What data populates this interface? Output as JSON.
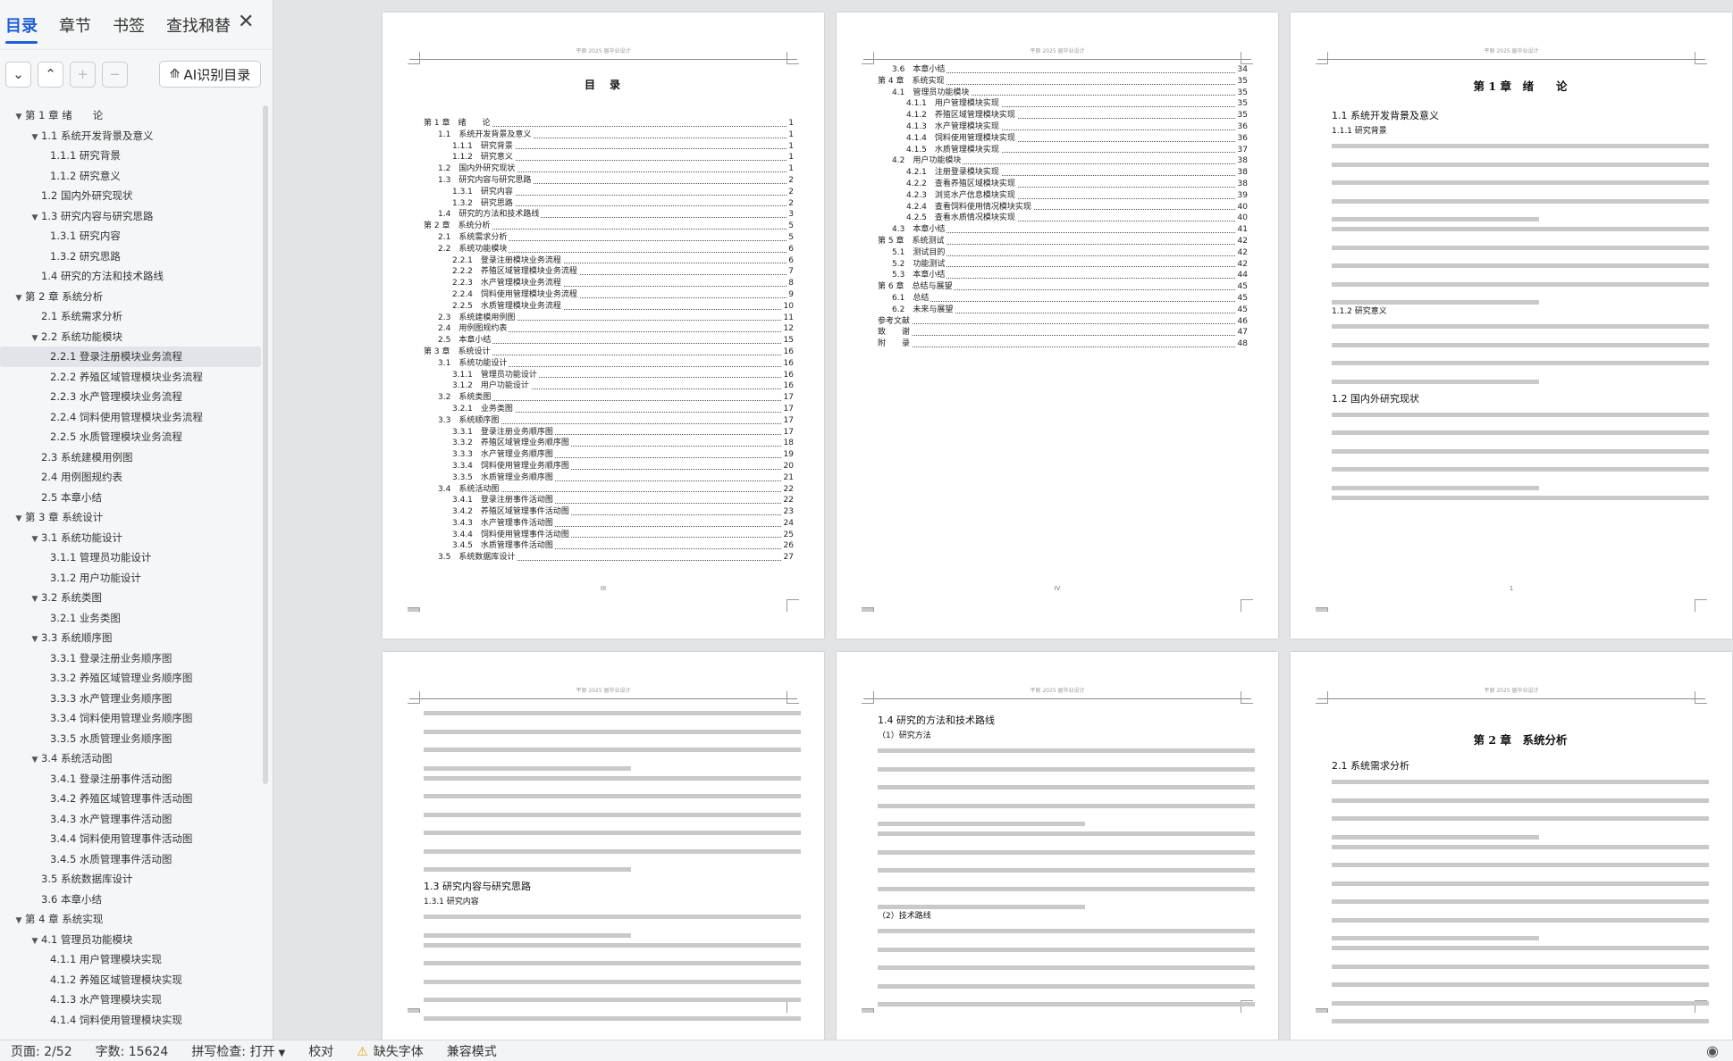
{
  "sidebar": {
    "tabs": [
      "目录",
      "章节",
      "书签",
      "查找和替"
    ],
    "ai_button": "AI识别目录",
    "toc": [
      {
        "label": "第 1 章 绪　　论",
        "level": 1
      },
      {
        "label": "1.1 系统开发背景及意义",
        "level": 2
      },
      {
        "label": "1.1.1 研究背景",
        "level": 3
      },
      {
        "label": "1.1.2 研究意义",
        "level": 3
      },
      {
        "label": "1.2 国内外研究现状",
        "level": 2,
        "leaf": true
      },
      {
        "label": "1.3 研究内容与研究思路",
        "level": 2
      },
      {
        "label": "1.3.1 研究内容",
        "level": 3
      },
      {
        "label": "1.3.2 研究思路",
        "level": 3
      },
      {
        "label": "1.4 研究的方法和技术路线",
        "level": 2,
        "leaf": true
      },
      {
        "label": "第 2 章 系统分析",
        "level": 1
      },
      {
        "label": "2.1 系统需求分析",
        "level": 2,
        "leaf": true
      },
      {
        "label": "2.2 系统功能模块",
        "level": 2
      },
      {
        "label": "2.2.1 登录注册模块业务流程",
        "level": 3,
        "selected": true
      },
      {
        "label": "2.2.2 养殖区域管理模块业务流程",
        "level": 3
      },
      {
        "label": "2.2.3 水产管理模块业务流程",
        "level": 3
      },
      {
        "label": "2.2.4 饲料使用管理模块业务流程",
        "level": 3
      },
      {
        "label": "2.2.5 水质管理模块业务流程",
        "level": 3
      },
      {
        "label": "2.3 系统建模用例图",
        "level": 2,
        "leaf": true
      },
      {
        "label": "2.4 用例图规约表",
        "level": 2,
        "leaf": true
      },
      {
        "label": "2.5 本章小结",
        "level": 2,
        "leaf": true
      },
      {
        "label": "第 3 章 系统设计",
        "level": 1
      },
      {
        "label": "3.1 系统功能设计",
        "level": 2
      },
      {
        "label": "3.1.1 管理员功能设计",
        "level": 3
      },
      {
        "label": "3.1.2 用户功能设计",
        "level": 3
      },
      {
        "label": "3.2 系统类图",
        "level": 2
      },
      {
        "label": "3.2.1 业务类图",
        "level": 3
      },
      {
        "label": "3.3 系统顺序图",
        "level": 2
      },
      {
        "label": "3.3.1 登录注册业务顺序图",
        "level": 3
      },
      {
        "label": "3.3.2 养殖区域管理业务顺序图",
        "level": 3
      },
      {
        "label": "3.3.3 水产管理业务顺序图",
        "level": 3
      },
      {
        "label": "3.3.4 饲料使用管理业务顺序图",
        "level": 3
      },
      {
        "label": "3.3.5 水质管理业务顺序图",
        "level": 3
      },
      {
        "label": "3.4 系统活动图",
        "level": 2
      },
      {
        "label": "3.4.1 登录注册事件活动图",
        "level": 3
      },
      {
        "label": "3.4.2 养殖区域管理事件活动图",
        "level": 3
      },
      {
        "label": "3.4.3 水产管理事件活动图",
        "level": 3
      },
      {
        "label": "3.4.4 饲料使用管理事件活动图",
        "level": 3
      },
      {
        "label": "3.4.5 水质管理事件活动图",
        "level": 3
      },
      {
        "label": "3.5 系统数据库设计",
        "level": 2,
        "leaf": true
      },
      {
        "label": "3.6 本章小结",
        "level": 2,
        "leaf": true
      },
      {
        "label": "第 4 章 系统实现",
        "level": 1
      },
      {
        "label": "4.1 管理员功能模块",
        "level": 2
      },
      {
        "label": "4.1.1 用户管理模块实现",
        "level": 3
      },
      {
        "label": "4.1.2 养殖区域管理模块实现",
        "level": 3
      },
      {
        "label": "4.1.3 水产管理模块实现",
        "level": 3
      },
      {
        "label": "4.1.4 饲料使用管理模块实现",
        "level": 3
      }
    ]
  },
  "document": {
    "header_text": "平原 2025 届毕业设计",
    "toc_title": "目　录",
    "toc_page1": [
      {
        "t": "第 1 章　绪　　论",
        "p": "1",
        "ind": 0
      },
      {
        "t": "1.1　系统开发背景及意义",
        "p": "1",
        "ind": 1
      },
      {
        "t": "1.1.1　研究背景",
        "p": "1",
        "ind": 2
      },
      {
        "t": "1.1.2　研究意义",
        "p": "1",
        "ind": 2
      },
      {
        "t": "1.2　国内外研究现状",
        "p": "1",
        "ind": 1
      },
      {
        "t": "1.3　研究内容与研究思路",
        "p": "2",
        "ind": 1
      },
      {
        "t": "1.3.1　研究内容",
        "p": "2",
        "ind": 2
      },
      {
        "t": "1.3.2　研究思路",
        "p": "2",
        "ind": 2
      },
      {
        "t": "1.4　研究的方法和技术路线",
        "p": "3",
        "ind": 1
      },
      {
        "t": "第 2 章　系统分析",
        "p": "5",
        "ind": 0
      },
      {
        "t": "2.1　系统需求分析",
        "p": "5",
        "ind": 1
      },
      {
        "t": "2.2　系统功能模块",
        "p": "6",
        "ind": 1
      },
      {
        "t": "2.2.1　登录注册模块业务流程",
        "p": "6",
        "ind": 2
      },
      {
        "t": "2.2.2　养殖区域管理模块业务流程",
        "p": "7",
        "ind": 2
      },
      {
        "t": "2.2.3　水产管理模块业务流程",
        "p": "8",
        "ind": 2
      },
      {
        "t": "2.2.4　饲料使用管理模块业务流程",
        "p": "9",
        "ind": 2
      },
      {
        "t": "2.2.5　水质管理模块业务流程",
        "p": "10",
        "ind": 2
      },
      {
        "t": "2.3　系统建模用例图",
        "p": "11",
        "ind": 1
      },
      {
        "t": "2.4　用例图规约表",
        "p": "12",
        "ind": 1
      },
      {
        "t": "2.5　本章小结",
        "p": "15",
        "ind": 1
      },
      {
        "t": "第 3 章　系统设计",
        "p": "16",
        "ind": 0
      },
      {
        "t": "3.1　系统功能设计",
        "p": "16",
        "ind": 1
      },
      {
        "t": "3.1.1　管理员功能设计",
        "p": "16",
        "ind": 2
      },
      {
        "t": "3.1.2　用户功能设计",
        "p": "16",
        "ind": 2
      },
      {
        "t": "3.2　系统类图",
        "p": "17",
        "ind": 1
      },
      {
        "t": "3.2.1　业务类图",
        "p": "17",
        "ind": 2
      },
      {
        "t": "3.3　系统顺序图",
        "p": "17",
        "ind": 1
      },
      {
        "t": "3.3.1　登录注册业务顺序图",
        "p": "17",
        "ind": 2
      },
      {
        "t": "3.3.2　养殖区域管理业务顺序图",
        "p": "18",
        "ind": 2
      },
      {
        "t": "3.3.3　水产管理业务顺序图",
        "p": "19",
        "ind": 2
      },
      {
        "t": "3.3.4　饲料使用管理业务顺序图",
        "p": "20",
        "ind": 2
      },
      {
        "t": "3.3.5　水质管理业务顺序图",
        "p": "21",
        "ind": 2
      },
      {
        "t": "3.4　系统活动图",
        "p": "22",
        "ind": 1
      },
      {
        "t": "3.4.1　登录注册事件活动图",
        "p": "22",
        "ind": 2
      },
      {
        "t": "3.4.2　养殖区域管理事件活动图",
        "p": "23",
        "ind": 2
      },
      {
        "t": "3.4.3　水产管理事件活动图",
        "p": "24",
        "ind": 2
      },
      {
        "t": "3.4.4　饲料使用管理事件活动图",
        "p": "25",
        "ind": 2
      },
      {
        "t": "3.4.5　水质管理事件活动图",
        "p": "26",
        "ind": 2
      },
      {
        "t": "3.5　系统数据库设计",
        "p": "27",
        "ind": 1
      }
    ],
    "toc_page2": [
      {
        "t": "3.6　本章小结",
        "p": "34",
        "ind": 1
      },
      {
        "t": "第 4 章　系统实现",
        "p": "35",
        "ind": 0
      },
      {
        "t": "4.1　管理员功能模块",
        "p": "35",
        "ind": 1
      },
      {
        "t": "4.1.1　用户管理模块实现",
        "p": "35",
        "ind": 2
      },
      {
        "t": "4.1.2　养殖区域管理模块实现",
        "p": "35",
        "ind": 2
      },
      {
        "t": "4.1.3　水产管理模块实现",
        "p": "36",
        "ind": 2
      },
      {
        "t": "4.1.4　饲料使用管理模块实现",
        "p": "36",
        "ind": 2
      },
      {
        "t": "4.1.5　水质管理模块实现",
        "p": "37",
        "ind": 2
      },
      {
        "t": "4.2　用户功能模块",
        "p": "38",
        "ind": 1
      },
      {
        "t": "4.2.1　注册登录模块实现",
        "p": "38",
        "ind": 2
      },
      {
        "t": "4.2.2　查看养殖区域模块实现",
        "p": "38",
        "ind": 2
      },
      {
        "t": "4.2.3　浏览水产信息模块实现",
        "p": "39",
        "ind": 2
      },
      {
        "t": "4.2.4　查看饲料使用情况模块实现",
        "p": "40",
        "ind": 2
      },
      {
        "t": "4.2.5　查看水质情况模块实现",
        "p": "40",
        "ind": 2
      },
      {
        "t": "4.3　本章小结",
        "p": "41",
        "ind": 1
      },
      {
        "t": "第 5 章　系统测试",
        "p": "42",
        "ind": 0
      },
      {
        "t": "5.1　测试目的",
        "p": "42",
        "ind": 1
      },
      {
        "t": "5.2　功能测试",
        "p": "42",
        "ind": 1
      },
      {
        "t": "5.3　本章小结",
        "p": "44",
        "ind": 1
      },
      {
        "t": "第 6 章　总结与展望",
        "p": "45",
        "ind": 0
      },
      {
        "t": "6.1　总结",
        "p": "45",
        "ind": 1
      },
      {
        "t": "6.2　未来与展望",
        "p": "45",
        "ind": 1
      },
      {
        "t": "参考文献",
        "p": "46",
        "ind": 0
      },
      {
        "t": "致　　谢",
        "p": "47",
        "ind": 0
      },
      {
        "t": "附　　录",
        "p": "48",
        "ind": 0
      }
    ],
    "page_numbers": [
      "III",
      "IV",
      "1"
    ],
    "p3": {
      "chapter": "第 1 章　绪　　论",
      "h2a": "1.1 系统开发背景及意义",
      "h3a": "1.1.1 研究背景",
      "h3b": "1.1.2 研究意义",
      "h2b": "1.2 国内外研究现状"
    },
    "p4": {
      "h2": "1.3 研究内容与研究思路",
      "h3": "1.3.1 研究内容"
    },
    "p5": {
      "h2": "1.4 研究的方法和技术路线",
      "h3a": "（1）研究方法",
      "h3b": "（2）技术路线"
    },
    "p6": {
      "chapter": "第 2 章　系统分析",
      "h2": "2.1 系统需求分析"
    }
  },
  "status": {
    "page": "页面: 2/52",
    "words": "字数: 15624",
    "spell": "拼写检查: 打开",
    "proof": "校对",
    "font_missing": "缺失字体",
    "compat": "兼容模式"
  }
}
